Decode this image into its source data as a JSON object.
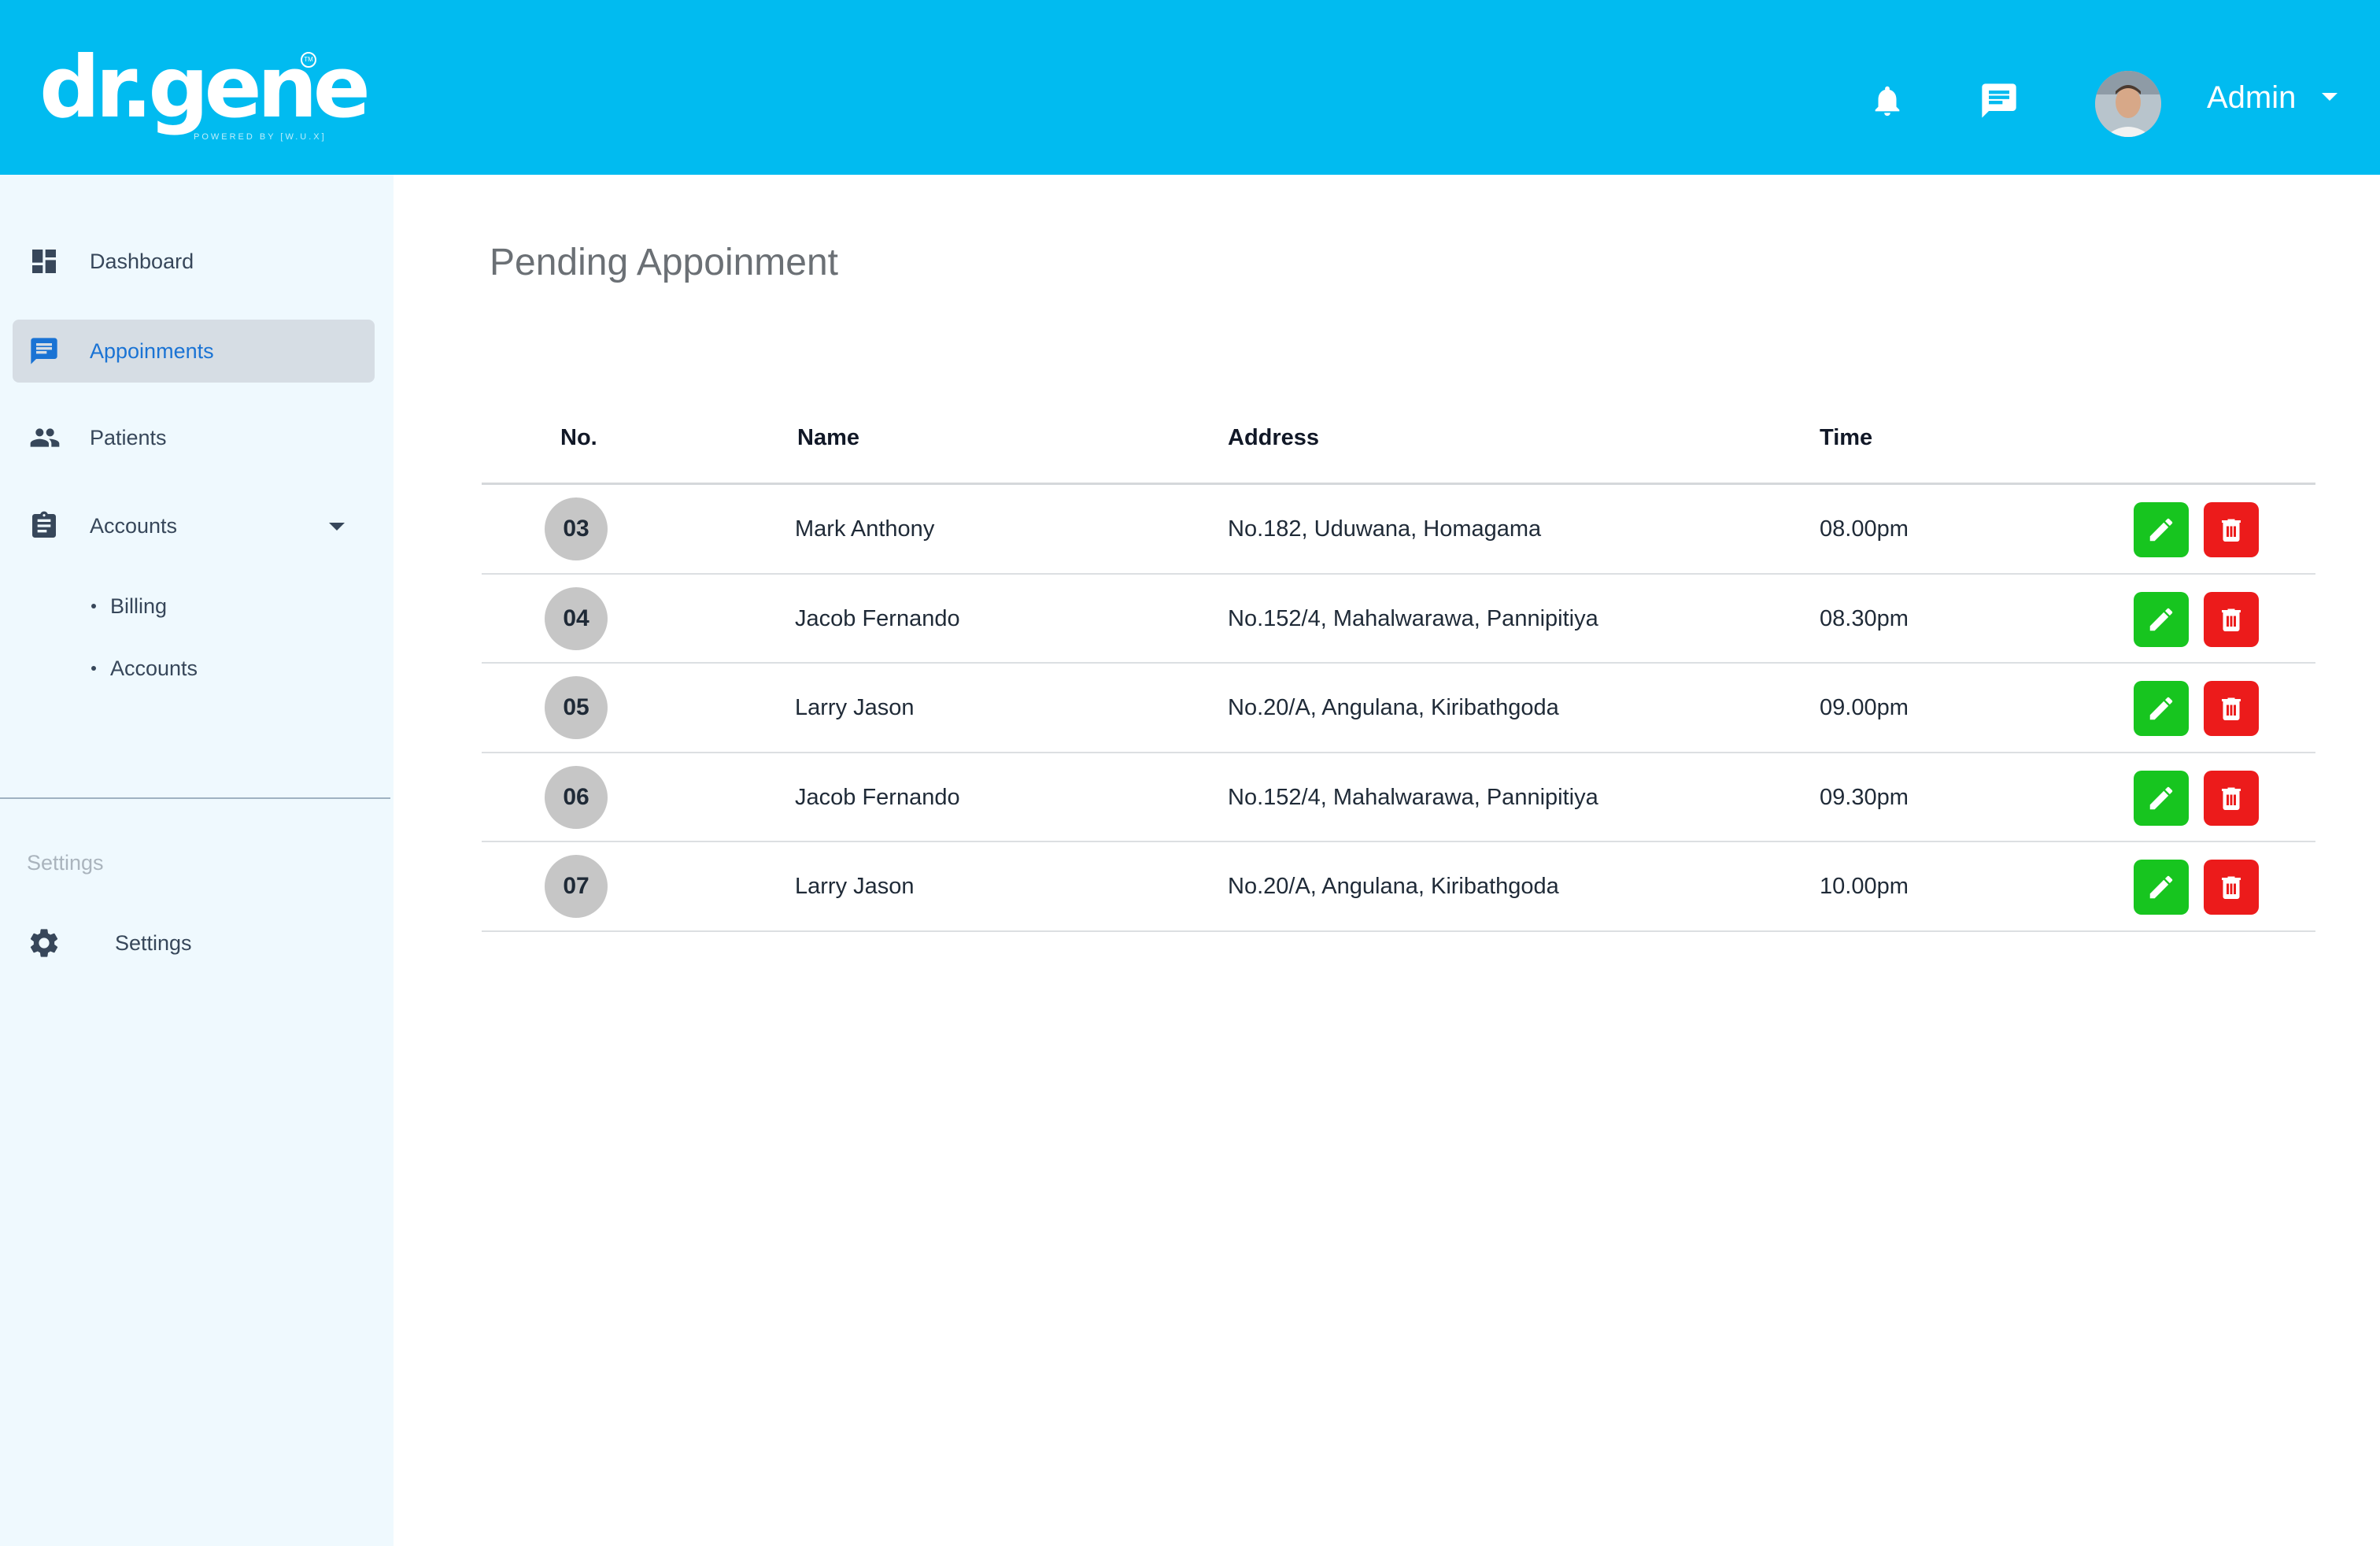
{
  "header": {
    "logo_text": "dr.gene",
    "logo_tagline": "POWERED BY [W.U.X]",
    "logo_tm": "TM",
    "user_name": "Admin"
  },
  "colors": {
    "header_bg": "#01bbf0",
    "sidebar_bg": "#eff9fe",
    "active_nav_bg": "#d6dde4",
    "active_nav_text": "#1a73d4",
    "edit_button": "#17c51f",
    "delete_button": "#ec1b1b",
    "number_badge": "#c6c6c6"
  },
  "sidebar": {
    "items": [
      {
        "label": "Dashboard",
        "icon": "dashboard-icon"
      },
      {
        "label": "Appoinments",
        "icon": "chat-icon",
        "active": true
      },
      {
        "label": "Patients",
        "icon": "people-icon"
      },
      {
        "label": "Accounts",
        "icon": "clipboard-icon",
        "expanded": true
      }
    ],
    "sub_items": [
      {
        "label": "Billing"
      },
      {
        "label": "Accounts"
      }
    ],
    "section_label": "Settings",
    "settings_label": "Settings"
  },
  "main": {
    "title": "Pending Appoinment",
    "columns": [
      "No.",
      "Name",
      "Address",
      "Time"
    ],
    "rows": [
      {
        "no": "03",
        "name": "Mark Anthony",
        "address": "No.182, Uduwana, Homagama",
        "time": "08.00pm"
      },
      {
        "no": "04",
        "name": "Jacob Fernando",
        "address": "No.152/4, Mahalwarawa, Pannipitiya",
        "time": "08.30pm"
      },
      {
        "no": "05",
        "name": "Larry Jason",
        "address": "No.20/A, Angulana, Kiribathgoda",
        "time": "09.00pm"
      },
      {
        "no": "06",
        "name": "Jacob Fernando",
        "address": "No.152/4, Mahalwarawa, Pannipitiya",
        "time": "09.30pm"
      },
      {
        "no": "07",
        "name": "Larry Jason",
        "address": "No.20/A, Angulana, Kiribathgoda",
        "time": "10.00pm"
      }
    ]
  }
}
